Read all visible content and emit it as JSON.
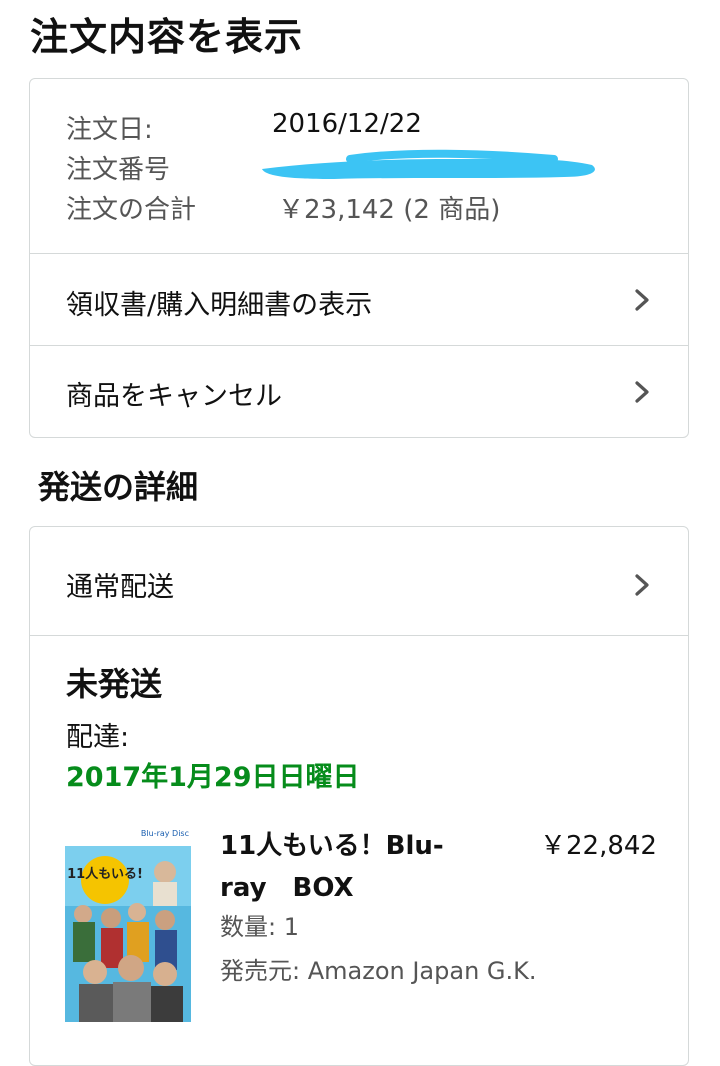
{
  "header": {
    "title": "注文内容を表示"
  },
  "summary": {
    "order_date_label": "注文日:",
    "order_date_value": "2016/12/22",
    "order_number_label": "注文番号",
    "order_total_label": "注文の合計",
    "order_total_value": "￥23,142 (2 商品)",
    "redaction_color": "#3cc4f4"
  },
  "actions": [
    {
      "label": "領収書/購入明細書の表示",
      "icon": "chevron-right-icon"
    },
    {
      "label": "商品をキャンセル",
      "icon": "chevron-right-icon"
    }
  ],
  "shipping": {
    "section_title": "発送の詳細",
    "method_label": "通常配送",
    "method_icon": "chevron-right-icon",
    "status": "未発送",
    "delivery_label": "配達:",
    "delivery_date": "2017年1月29日日曜日",
    "delivery_date_color": "#068c1b",
    "item": {
      "title_line1": "11人もいる！Blu-",
      "title_line2": "ray　BOX",
      "price": "￥22,842",
      "quantity": "数量: 1",
      "seller": "発売元: Amazon Japan G.K.",
      "image": "product-bluray-cover",
      "image_badge": "Blu-ray Disc",
      "image_text": "11人もいる!"
    }
  }
}
